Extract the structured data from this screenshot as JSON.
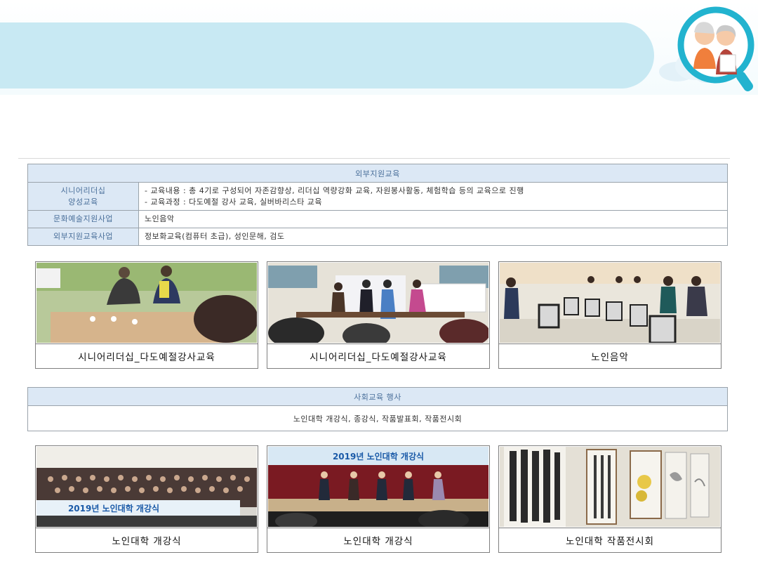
{
  "outreach_table": {
    "header": "외부지원교육",
    "rows": [
      {
        "label_line1": "시니어리더십",
        "label_line2": "양성교육",
        "value_line1": "- 교육내용 : 총 4기로 구성되어 자존감향상, 리더십 역량강화 교육, 자원봉사활동, 체험학습 등의 교육으로 진행",
        "value_line2": "- 교육과정 : 다도예절 강사 교육, 실버바리스타 교육"
      },
      {
        "label": "문화예술지원사업",
        "value": "노인음악"
      },
      {
        "label": "외부지원교육사업",
        "value": "정보화교육(컴퓨터 초급), 성인문해, 검도"
      }
    ]
  },
  "photos_row1": [
    {
      "caption": "시니어리더십_다도예절강사교육"
    },
    {
      "caption": "시니어리더십_다도예절강사교육"
    },
    {
      "caption": "노인음악"
    }
  ],
  "social_table": {
    "header": "사회교육 행사",
    "body": "노인대학 개강식, 종강식, 작품발표회, 작품전시회"
  },
  "photos_row2": [
    {
      "caption": "노인대학 개강식",
      "banner_text": "2019년 노인대학 개강식"
    },
    {
      "caption": "노인대학 개강식",
      "banner_text": "2019년 노인대학 개강식"
    },
    {
      "caption": "노인대학 작품전시회"
    }
  ],
  "colors": {
    "title_pill": "#c8e9f3",
    "table_header_bg": "#dce8f5",
    "table_header_text": "#4a6f9a",
    "border": "#9aa3ab"
  },
  "icons": [
    "cloud-icon",
    "magnifier-icon",
    "elderly-couple-icon"
  ]
}
